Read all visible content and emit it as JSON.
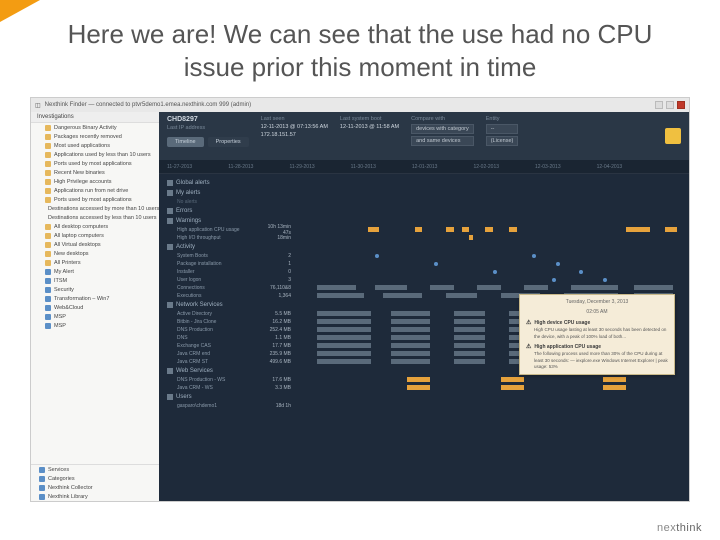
{
  "slide": {
    "title": "Here we are! We can see that the use had no CPU issue prior this moment in time",
    "brand_prefix": "nex",
    "brand_suffix": "think"
  },
  "window": {
    "title": "Nexthink Finder — connected to ptvr5demo1.emea.nexthink.com 999 (admin)"
  },
  "sidebar": {
    "header": "Investigations",
    "items": [
      "Dangerous Binary Activity",
      "Packages recently removed",
      "Most used applications",
      "Applications used by less than 10 users",
      "Ports used by most applications",
      "Recent New binaries",
      "High Privilege accounts",
      "Applications run from net drive",
      "Ports used by most applications",
      "Destinations accessed by more than 10 users",
      "Destinations accessed by less than 10 users",
      "All desktop computers",
      "All laptop computers",
      "All Virtual desktops",
      "New desktops",
      "All Printers",
      "My Alert",
      "ITSM",
      "Security",
      "Transformation – Win7",
      "Web&Cloud",
      "MSP",
      "MSP"
    ],
    "bottom": [
      "Services",
      "Categories",
      "Nexthink Collector",
      "Nexthink Library"
    ]
  },
  "topbar": {
    "device": "CHD8297",
    "last_seen_label": "Last seen",
    "last_seen": "12-11-2013 @ 07:13:56 AM",
    "last_ip_label": "Last IP address",
    "last_ip": "172.18.151.57",
    "boot_label": "Last system boot",
    "boot": "12-11-2013 @ 11:58 AM",
    "compare_label": "Compare with",
    "compare_with": "devices with category",
    "entity_label": "Entity",
    "entity": "--",
    "same_label": "and same devices",
    "same": "(License)",
    "tabs": [
      "Timeline",
      "Properties"
    ]
  },
  "timeline": {
    "dates": [
      "11-27-2013",
      "11-28-2013",
      "11-29-2013",
      "11-30-2013",
      "12-01-2013",
      "12-02-2013",
      "12-03-2013",
      "12-04-2013"
    ]
  },
  "sections": {
    "global_alerts": "Global alerts",
    "my_alerts": "My alerts",
    "my_alerts_sub": "No alerts",
    "errors": "Errors",
    "warnings": "Warnings",
    "warn_rows": [
      {
        "label": "High application CPU usage",
        "value": "10h 13min 47s"
      },
      {
        "label": "High I/O throughput",
        "value": "18min"
      }
    ],
    "activity": "Activity",
    "activity_rows": [
      {
        "label": "System Boots",
        "value": "2"
      },
      {
        "label": "Package installation",
        "value": "1"
      },
      {
        "label": "Installer",
        "value": "0"
      },
      {
        "label": "User logon",
        "value": "3"
      },
      {
        "label": "Connections",
        "value": "76,110&8"
      },
      {
        "label": "Executions",
        "value": "1,364"
      }
    ],
    "network": "Network Services",
    "network_rows": [
      {
        "label": "Active Directory",
        "value": "5.5 MB"
      },
      {
        "label": "Bitbin - Jira Clone",
        "value": "16.2 MB"
      },
      {
        "label": "DNS Production",
        "value": "252.4 MB"
      },
      {
        "label": "DNS",
        "value": "1.1 MB"
      },
      {
        "label": "Exchange CAS",
        "value": "17.7 MB"
      },
      {
        "label": "Java CRM end",
        "value": "235.9 MB"
      },
      {
        "label": "Java CRM ST",
        "value": "499.6 MB"
      }
    ],
    "web": "Web Services",
    "web_rows": [
      {
        "label": "DNS Production - WS",
        "value": "17.6 MB"
      },
      {
        "label": "Java CRM - WS",
        "value": "3.3 MB"
      }
    ],
    "users": "Users",
    "users_rows": [
      {
        "label": "gasparo\\chdemo1",
        "value": "18d 1h"
      }
    ]
  },
  "tooltip": {
    "date": "Tuesday, December 3, 2013",
    "time": "02:05 AM",
    "items": [
      {
        "h": "High device CPU usage",
        "b": "High CPU usage lasting at least 30 seconds has been detected on the device, with a peak of 100% load of both..."
      },
      {
        "h": "High application CPU usage",
        "b": "The following process used more than 30% of the CPU during at least 30 seconds:\n— iexplore.exe Windows Internet Explorer | peak usage: 53%"
      }
    ]
  }
}
